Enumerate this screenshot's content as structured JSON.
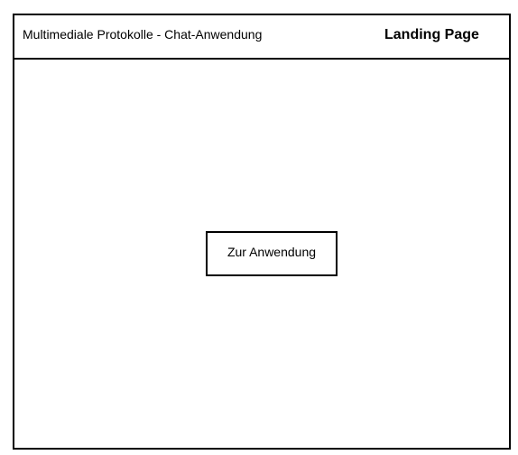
{
  "header": {
    "app_title": "Multimediale Protokolle - Chat-Anwendung",
    "page_label": "Landing Page"
  },
  "main": {
    "cta_label": "Zur Anwendung"
  }
}
